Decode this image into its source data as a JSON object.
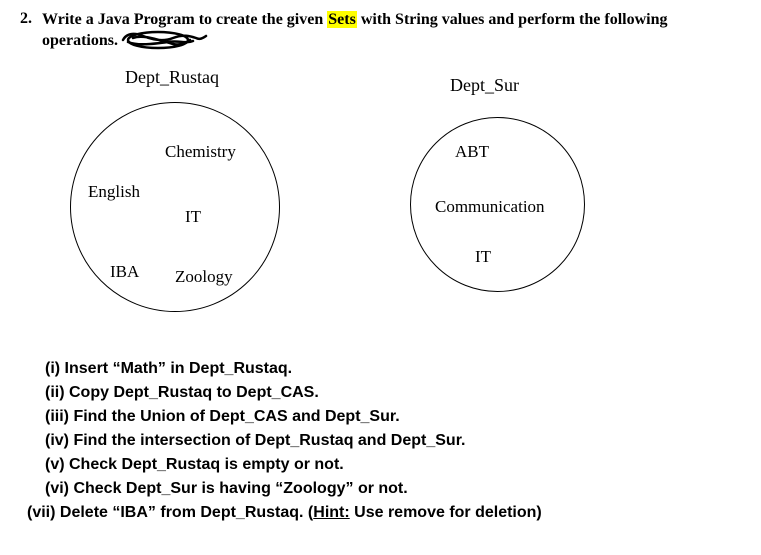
{
  "question": {
    "number": "2.",
    "text_part1": "Write a Java Program to create the given ",
    "text_sets": "Sets",
    "text_part2": " with String values and perform the following operations."
  },
  "diagram": {
    "set1": {
      "label": "Dept_Rustaq",
      "items": {
        "chemistry": "Chemistry",
        "english": "English",
        "it": "IT",
        "iba": "IBA",
        "zoology": "Zoology"
      }
    },
    "set2": {
      "label": "Dept_Sur",
      "items": {
        "abt": "ABT",
        "communication": "Communication",
        "it": "IT"
      }
    }
  },
  "tasks": {
    "i": "(i) Insert “Math” in Dept_Rustaq.",
    "ii": "(ii) Copy Dept_Rustaq to Dept_CAS.",
    "iii": "(iii) Find the Union of Dept_CAS and Dept_Sur.",
    "iv": "(iv) Find the intersection of Dept_Rustaq and Dept_Sur.",
    "v": "(v) Check Dept_Rustaq is empty or not.",
    "vi": "(vi) Check Dept_Sur is having “Zoology” or not.",
    "vii_part1": "(vii) Delete “IBA” from Dept_Rustaq. (",
    "vii_hint": "Hint:",
    "vii_part2": " Use remove for deletion)"
  }
}
